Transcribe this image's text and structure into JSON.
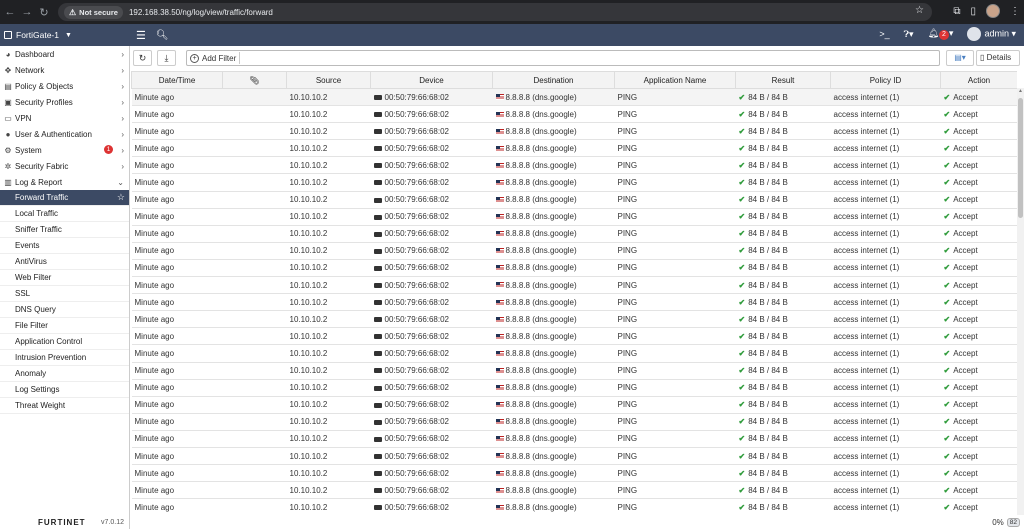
{
  "browser": {
    "security_label": "Not secure",
    "url": "192.168.38.50/ng/log/view/traffic/forward"
  },
  "header": {
    "device_name": "FortiGate-1",
    "notification_count": "2",
    "user": "admin"
  },
  "sidebar": {
    "items": [
      {
        "label": "Dashboard"
      },
      {
        "label": "Network"
      },
      {
        "label": "Policy & Objects"
      },
      {
        "label": "Security Profiles"
      },
      {
        "label": "VPN"
      },
      {
        "label": "User & Authentication"
      },
      {
        "label": "System",
        "badge": "1"
      },
      {
        "label": "Security Fabric"
      },
      {
        "label": "Log & Report"
      }
    ],
    "log_items": [
      {
        "label": "Forward Traffic"
      },
      {
        "label": "Local Traffic"
      },
      {
        "label": "Sniffer Traffic"
      },
      {
        "label": "Events"
      },
      {
        "label": "AntiVirus"
      },
      {
        "label": "Web Filter"
      },
      {
        "label": "SSL"
      },
      {
        "label": "DNS Query"
      },
      {
        "label": "File Filter"
      },
      {
        "label": "Application Control"
      },
      {
        "label": "Intrusion Prevention"
      },
      {
        "label": "Anomaly"
      },
      {
        "label": "Log Settings"
      },
      {
        "label": "Threat Weight"
      }
    ],
    "footer_logo": "FURTINET",
    "version": "v7.0.12"
  },
  "toolbar": {
    "add_filter": "Add Filter",
    "details": "Details"
  },
  "table": {
    "columns": [
      "Date/Time",
      "",
      "Source",
      "Device",
      "Destination",
      "Application Name",
      "Result",
      "Policy ID",
      "Action"
    ],
    "row": {
      "datetime": "Minute ago",
      "source": "10.10.10.2",
      "device": "00:50:79:66:68:02",
      "destination": "8.8.8.8 (dns.google)",
      "application": "PING",
      "result": "84 B / 84 B",
      "policy": "access internet (1)",
      "action": "Accept"
    },
    "row_count": 25
  },
  "status": {
    "percent": "0%",
    "count": "82"
  }
}
